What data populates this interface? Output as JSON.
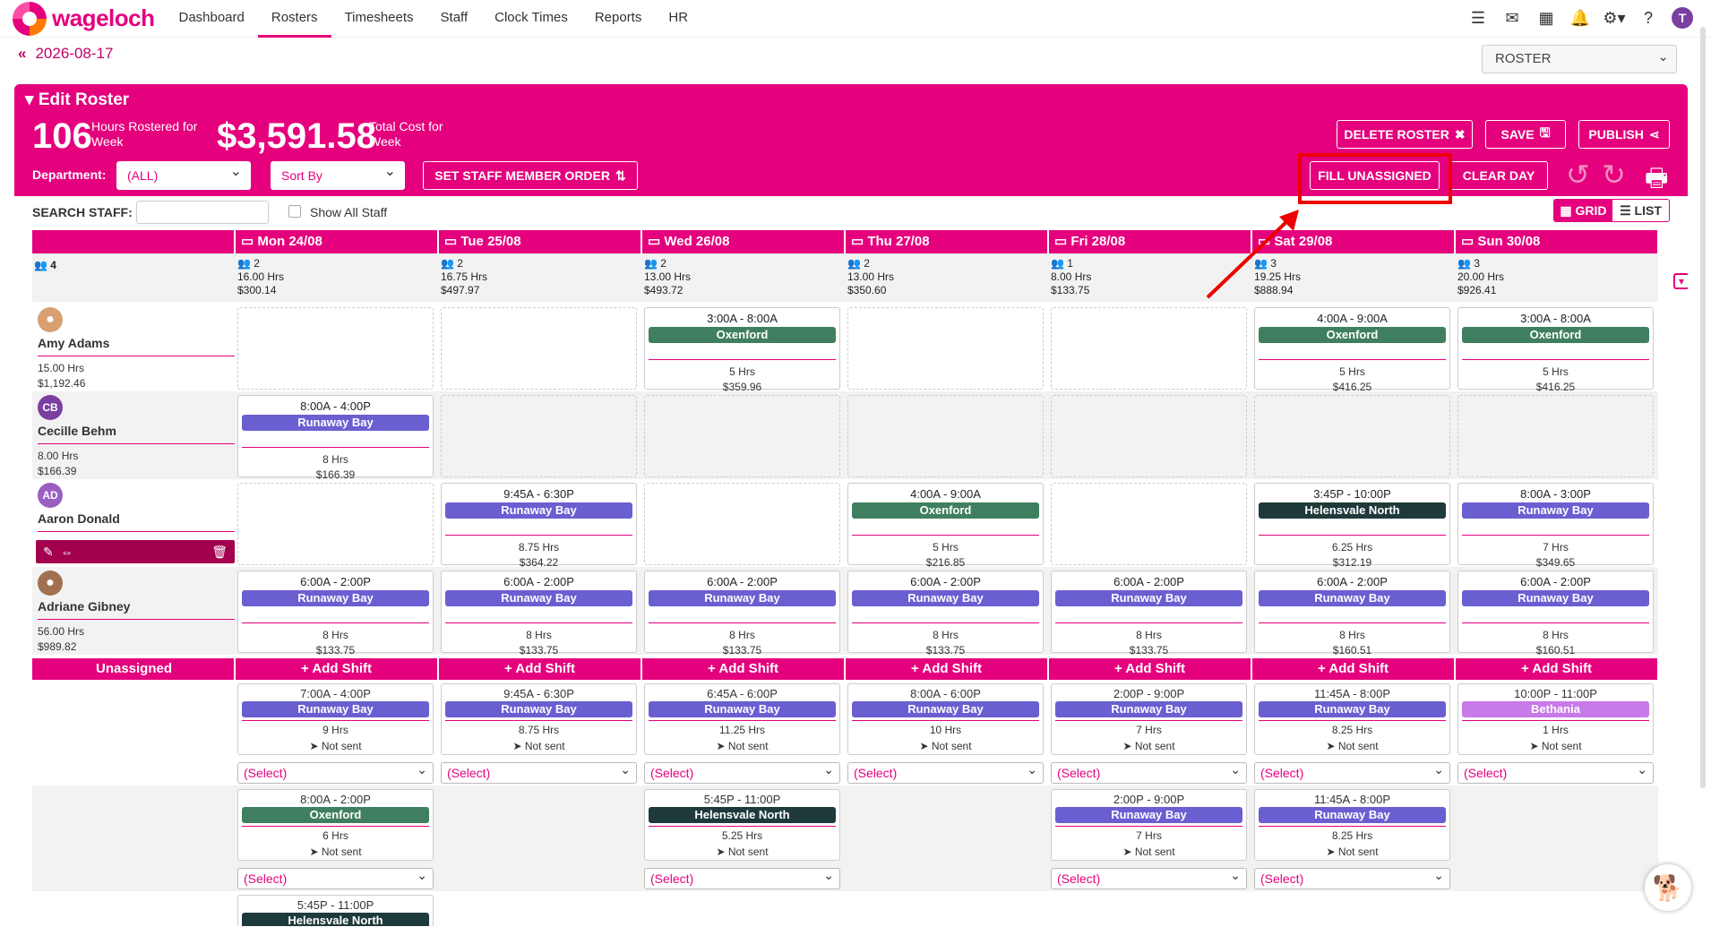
{
  "brand": "wageloch",
  "nav": [
    "Dashboard",
    "Rosters",
    "Timesheets",
    "Staff",
    "Clock Times",
    "Reports",
    "HR"
  ],
  "user_initial": "T",
  "date": "2026-08-17",
  "roster_select": "ROSTER",
  "header": {
    "title": "Edit Roster",
    "hours": "106",
    "hours_label_1": "Hours Rostered for",
    "hours_label_2": "Week",
    "cost": "$3,591.58",
    "cost_label_1": "Total Cost for",
    "cost_label_2": "Week"
  },
  "buttons": {
    "delete": "DELETE ROSTER",
    "save": "SAVE",
    "publish": "PUBLISH",
    "order": "SET STAFF MEMBER ORDER",
    "fill": "FILL UNASSIGNED",
    "clear": "CLEAR DAY",
    "grid": "GRID",
    "list": "LIST"
  },
  "filters": {
    "department_label": "Department:",
    "department": "(ALL)",
    "sort": "Sort By",
    "search_label": "SEARCH STAFF:",
    "show_all": "Show All Staff"
  },
  "days": [
    "Mon 24/08",
    "Tue 25/08",
    "Wed 26/08",
    "Thu 27/08",
    "Fri 28/08",
    "Sat 29/08",
    "Sun 30/08"
  ],
  "staff_total": "4",
  "day_summary": [
    {
      "n": "2",
      "hrs": "16.00 Hrs",
      "cost": "$300.14"
    },
    {
      "n": "2",
      "hrs": "16.75 Hrs",
      "cost": "$497.97"
    },
    {
      "n": "2",
      "hrs": "13.00 Hrs",
      "cost": "$493.72"
    },
    {
      "n": "2",
      "hrs": "13.00 Hrs",
      "cost": "$350.60"
    },
    {
      "n": "1",
      "hrs": "8.00 Hrs",
      "cost": "$133.75"
    },
    {
      "n": "3",
      "hrs": "19.25 Hrs",
      "cost": "$888.94"
    },
    {
      "n": "3",
      "hrs": "20.00 Hrs",
      "cost": "$926.41"
    }
  ],
  "staff": [
    {
      "name": "Amy Adams",
      "initials": "",
      "hrs": "15.00 Hrs",
      "cost": "$1,192.46"
    },
    {
      "name": "Cecille Behm",
      "initials": "CB",
      "hrs": "8.00 Hrs",
      "cost": "$166.39"
    },
    {
      "name": "Aaron Donald",
      "initials": "AD",
      "hrs": "",
      "cost": ""
    },
    {
      "name": "Adriane Gibney",
      "initials": "",
      "hrs": "56.00 Hrs",
      "cost": "$989.82"
    }
  ],
  "shifts": [
    [
      null,
      null,
      {
        "time": "3:00A - 8:00A",
        "loc": "Oxenford",
        "hrs": "5 Hrs",
        "cost": "$359.96"
      },
      null,
      null,
      {
        "time": "4:00A - 9:00A",
        "loc": "Oxenford",
        "hrs": "5 Hrs",
        "cost": "$416.25"
      },
      {
        "time": "3:00A - 8:00A",
        "loc": "Oxenford",
        "hrs": "5 Hrs",
        "cost": "$416.25"
      }
    ],
    [
      {
        "time": "8:00A - 4:00P",
        "loc": "Runaway Bay",
        "hrs": "8 Hrs",
        "cost": "$166.39"
      },
      null,
      null,
      null,
      null,
      null,
      null
    ],
    [
      null,
      {
        "time": "9:45A - 6:30P",
        "loc": "Runaway Bay",
        "hrs": "8.75 Hrs",
        "cost": "$364.22"
      },
      null,
      {
        "time": "4:00A - 9:00A",
        "loc": "Oxenford",
        "hrs": "5 Hrs",
        "cost": "$216.85"
      },
      null,
      {
        "time": "3:45P - 10:00P",
        "loc": "Helensvale North",
        "hrs": "6.25 Hrs",
        "cost": "$312.19"
      },
      {
        "time": "8:00A - 3:00P",
        "loc": "Runaway Bay",
        "hrs": "7 Hrs",
        "cost": "$349.65"
      }
    ],
    [
      {
        "time": "6:00A - 2:00P",
        "loc": "Runaway Bay",
        "hrs": "8 Hrs",
        "cost": "$133.75"
      },
      {
        "time": "6:00A - 2:00P",
        "loc": "Runaway Bay",
        "hrs": "8 Hrs",
        "cost": "$133.75"
      },
      {
        "time": "6:00A - 2:00P",
        "loc": "Runaway Bay",
        "hrs": "8 Hrs",
        "cost": "$133.75"
      },
      {
        "time": "6:00A - 2:00P",
        "loc": "Runaway Bay",
        "hrs": "8 Hrs",
        "cost": "$133.75"
      },
      {
        "time": "6:00A - 2:00P",
        "loc": "Runaway Bay",
        "hrs": "8 Hrs",
        "cost": "$133.75"
      },
      {
        "time": "6:00A - 2:00P",
        "loc": "Runaway Bay",
        "hrs": "8 Hrs",
        "cost": "$160.51"
      },
      {
        "time": "6:00A - 2:00P",
        "loc": "Runaway Bay",
        "hrs": "8 Hrs",
        "cost": "$160.51"
      }
    ]
  ],
  "unassigned_label": "Unassigned",
  "add_shift": "Add Shift",
  "not_sent": "Not sent",
  "select_placeholder": "(Select)",
  "unassigned": [
    [
      {
        "time": "7:00A - 4:00P",
        "loc": "Runaway Bay",
        "hrs": "9 Hrs"
      },
      {
        "time": "9:45A - 6:30P",
        "loc": "Runaway Bay",
        "hrs": "8.75 Hrs"
      },
      {
        "time": "6:45A - 6:00P",
        "loc": "Runaway Bay",
        "hrs": "11.25 Hrs"
      },
      {
        "time": "8:00A - 6:00P",
        "loc": "Runaway Bay",
        "hrs": "10 Hrs"
      },
      {
        "time": "2:00P - 9:00P",
        "loc": "Runaway Bay",
        "hrs": "7 Hrs"
      },
      {
        "time": "11:45A - 8:00P",
        "loc": "Runaway Bay",
        "hrs": "8.25 Hrs"
      },
      {
        "time": "10:00P - 11:00P",
        "loc": "Bethania",
        "hrs": "1 Hrs"
      }
    ],
    [
      {
        "time": "8:00A - 2:00P",
        "loc": "Oxenford",
        "hrs": "6 Hrs"
      },
      null,
      {
        "time": "5:45P - 11:00P",
        "loc": "Helensvale North",
        "hrs": "5.25 Hrs"
      },
      null,
      {
        "time": "2:00P - 9:00P",
        "loc": "Runaway Bay",
        "hrs": "7 Hrs"
      },
      {
        "time": "11:45A - 8:00P",
        "loc": "Runaway Bay",
        "hrs": "8.25 Hrs"
      },
      null
    ],
    [
      {
        "time": "5:45P - 11:00P",
        "loc": "Helensvale North",
        "hrs": ""
      },
      null,
      null,
      null,
      null,
      null,
      null
    ]
  ],
  "loc_colors": {
    "Runaway Bay": "#6a5fd1",
    "Oxenford": "#3f7f5f",
    "Helensvale North": "#1f3a3a",
    "Bethania": "#c77ae8"
  }
}
